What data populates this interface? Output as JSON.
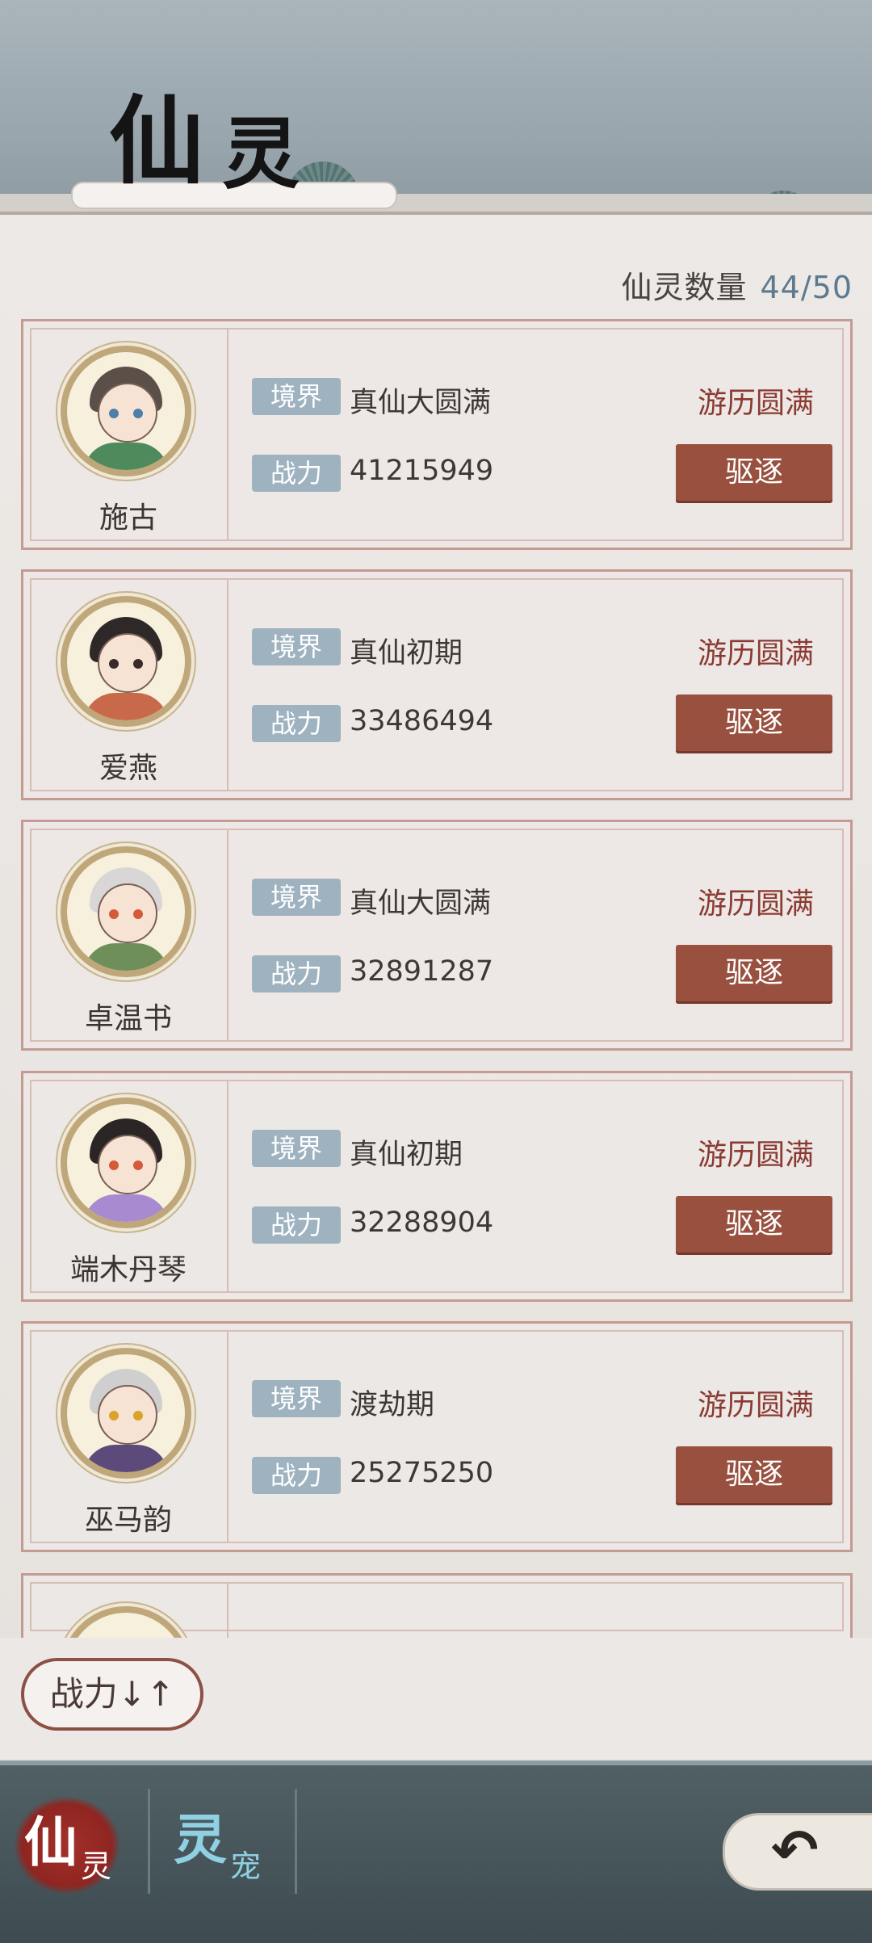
{
  "header": {
    "title_char1": "仙",
    "title_char2": "灵"
  },
  "summary": {
    "count_label": "仙灵数量",
    "count_value": "44/50"
  },
  "labels": {
    "realm": "境界",
    "power": "战力",
    "expel": "驱逐"
  },
  "cards": [
    {
      "name": "施古",
      "realm": "真仙大圆满",
      "power": "41215949",
      "status": "游历圆满",
      "hair": "#5b4f49",
      "outfit": "#4e8a5c",
      "eye": "#4d7fa8"
    },
    {
      "name": "爱燕",
      "realm": "真仙初期",
      "power": "33486494",
      "status": "游历圆满",
      "hair": "#2f2828",
      "outfit": "#c86a4a",
      "eye": "#3a2b2b"
    },
    {
      "name": "卓温书",
      "realm": "真仙大圆满",
      "power": "32891287",
      "status": "游历圆满",
      "hair": "#d8d6d6",
      "outfit": "#6e8f5a",
      "eye": "#d55a3a"
    },
    {
      "name": "端木丹琴",
      "realm": "真仙初期",
      "power": "32288904",
      "status": "游历圆满",
      "hair": "#2b2525",
      "outfit": "#a88ad0",
      "eye": "#d55a3a"
    },
    {
      "name": "巫马韵",
      "realm": "渡劫期",
      "power": "25275250",
      "status": "游历圆满",
      "hair": "#cfcfcf",
      "outfit": "#5c4a7a",
      "eye": "#d9a22a"
    }
  ],
  "sort": {
    "label": "战力↓↑"
  },
  "nav": {
    "tab1_big": "仙",
    "tab1_small": "灵",
    "tab2_big": "灵",
    "tab2_small": "宠"
  },
  "colors": {
    "accent": "#99503f",
    "tag_bg": "#9eb2bf",
    "status": "#8a3a32",
    "count_value": "#5d7a8f"
  }
}
